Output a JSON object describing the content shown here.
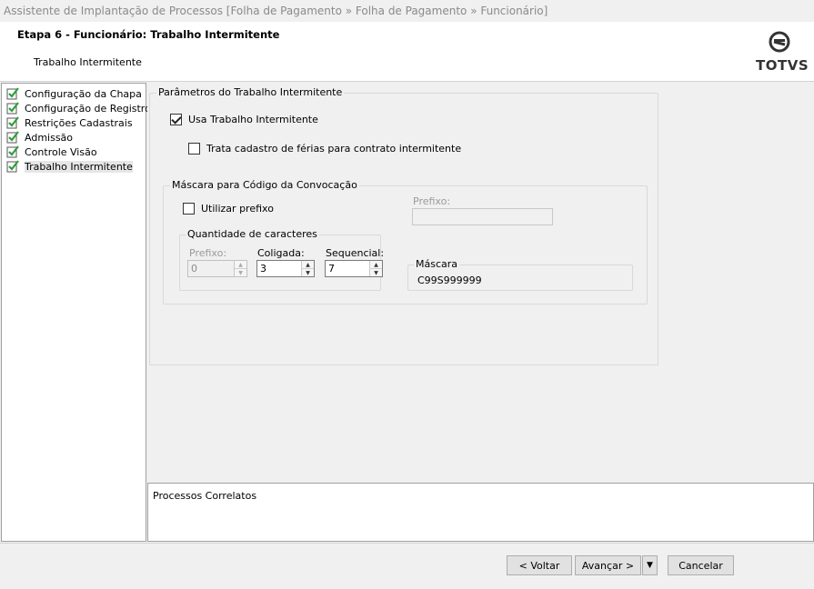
{
  "window": {
    "title": "Assistente de Implantação de Processos [Folha de Pagamento » Folha de Pagamento » Funcionário]"
  },
  "header": {
    "step_title": "Etapa 6 - Funcionário: Trabalho Intermitente",
    "step_subtitle": "Trabalho Intermitente",
    "logo_text": "TOTVS"
  },
  "tree": {
    "items": [
      {
        "label": "Configuração da Chapa",
        "checked": true
      },
      {
        "label": "Configuração de Registro",
        "checked": true
      },
      {
        "label": "Restrições Cadastrais",
        "checked": true
      },
      {
        "label": "Admissão",
        "checked": true
      },
      {
        "label": "Controle Visão",
        "checked": true
      },
      {
        "label": "Trabalho Intermitente",
        "checked": true,
        "selected": true
      }
    ]
  },
  "params": {
    "group_title": "Parâmetros do Trabalho Intermitente",
    "usa_trabalho_label": "Usa Trabalho Intermitente",
    "usa_trabalho_checked": true,
    "trata_ferias_label": "Trata cadastro de férias para contrato intermitente",
    "trata_ferias_checked": false
  },
  "mascara_group": {
    "title": "Máscara para Código da Convocação",
    "utilizar_prefixo_label": "Utilizar prefixo",
    "utilizar_prefixo_checked": false,
    "prefixo_label": "Prefixo:",
    "prefixo_value": "",
    "quantidade": {
      "title": "Quantidade de caracteres",
      "prefixo_label": "Prefixo:",
      "prefixo_value": "0",
      "coligada_label": "Coligada:",
      "coligada_value": "3",
      "sequencial_label": "Sequencial:",
      "sequencial_value": "7"
    },
    "mascara": {
      "title": "Máscara",
      "value": "C99S999999"
    }
  },
  "related": {
    "title": "Processos Correlatos"
  },
  "footer": {
    "back_label": "< Voltar",
    "next_label": "Avançar >",
    "dropdown_glyph": "▼",
    "cancel_label": "Cancelar"
  },
  "colors": {
    "check_green": "#2e9e3a",
    "window_bg": "#f0f0f0"
  }
}
